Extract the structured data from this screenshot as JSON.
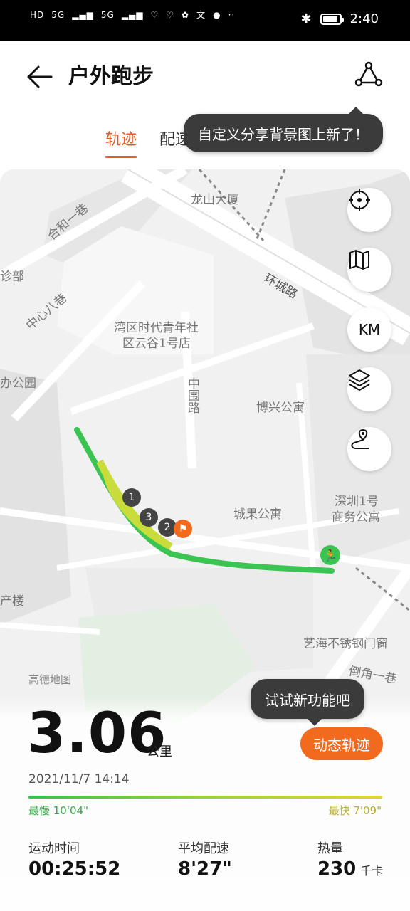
{
  "status_bar": {
    "left_text": [
      "HD",
      "5G",
      "5G"
    ],
    "time": "2:40"
  },
  "header": {
    "title": "户外跑步"
  },
  "tabs": [
    "轨迹",
    "配速"
  ],
  "tooltip_top": "自定义分享背景图上新了！",
  "map": {
    "controls": [
      "locate-icon",
      "map-icon",
      "KM",
      "layers-icon",
      "route-icon"
    ],
    "km_label": "KM",
    "labels": {
      "l1": "龙山大厦",
      "l2": "合和一巷",
      "l3": "环城路",
      "l4": "诊部",
      "l5": "中心八巷",
      "l6": "湾区时代青年社",
      "l7": "区云谷1号店",
      "l8": "办公园",
      "l9": "中围路",
      "l10": "博兴公寓",
      "l11": "深圳1号",
      "l12": "商务公寓",
      "l13": "城果公寓",
      "l14": "产楼",
      "l15": "艺海不锈钢门窗",
      "l16": "倒角一巷"
    },
    "km_markers": [
      "1",
      "3",
      "2"
    ],
    "provider": "高德地图"
  },
  "summary": {
    "distance": "3.06",
    "distance_unit": "公里",
    "datetime": "2021/11/7 14:14",
    "slowest": "最慢 10'04\"",
    "fastest": "最快 7'09\""
  },
  "stats": [
    {
      "label": "运动时间",
      "value": "00:25:52",
      "unit": ""
    },
    {
      "label": "平均配速",
      "value": "8'27\"",
      "unit": ""
    },
    {
      "label": "热量",
      "value": "230",
      "unit": "千卡"
    }
  ],
  "tooltip_bottom": "试试新功能吧",
  "dynamic_track_button": "动态轨迹",
  "colors": {
    "accent": "#f26a1e",
    "track_green": "#3cc453",
    "track_yellow": "#c9dc3c"
  }
}
